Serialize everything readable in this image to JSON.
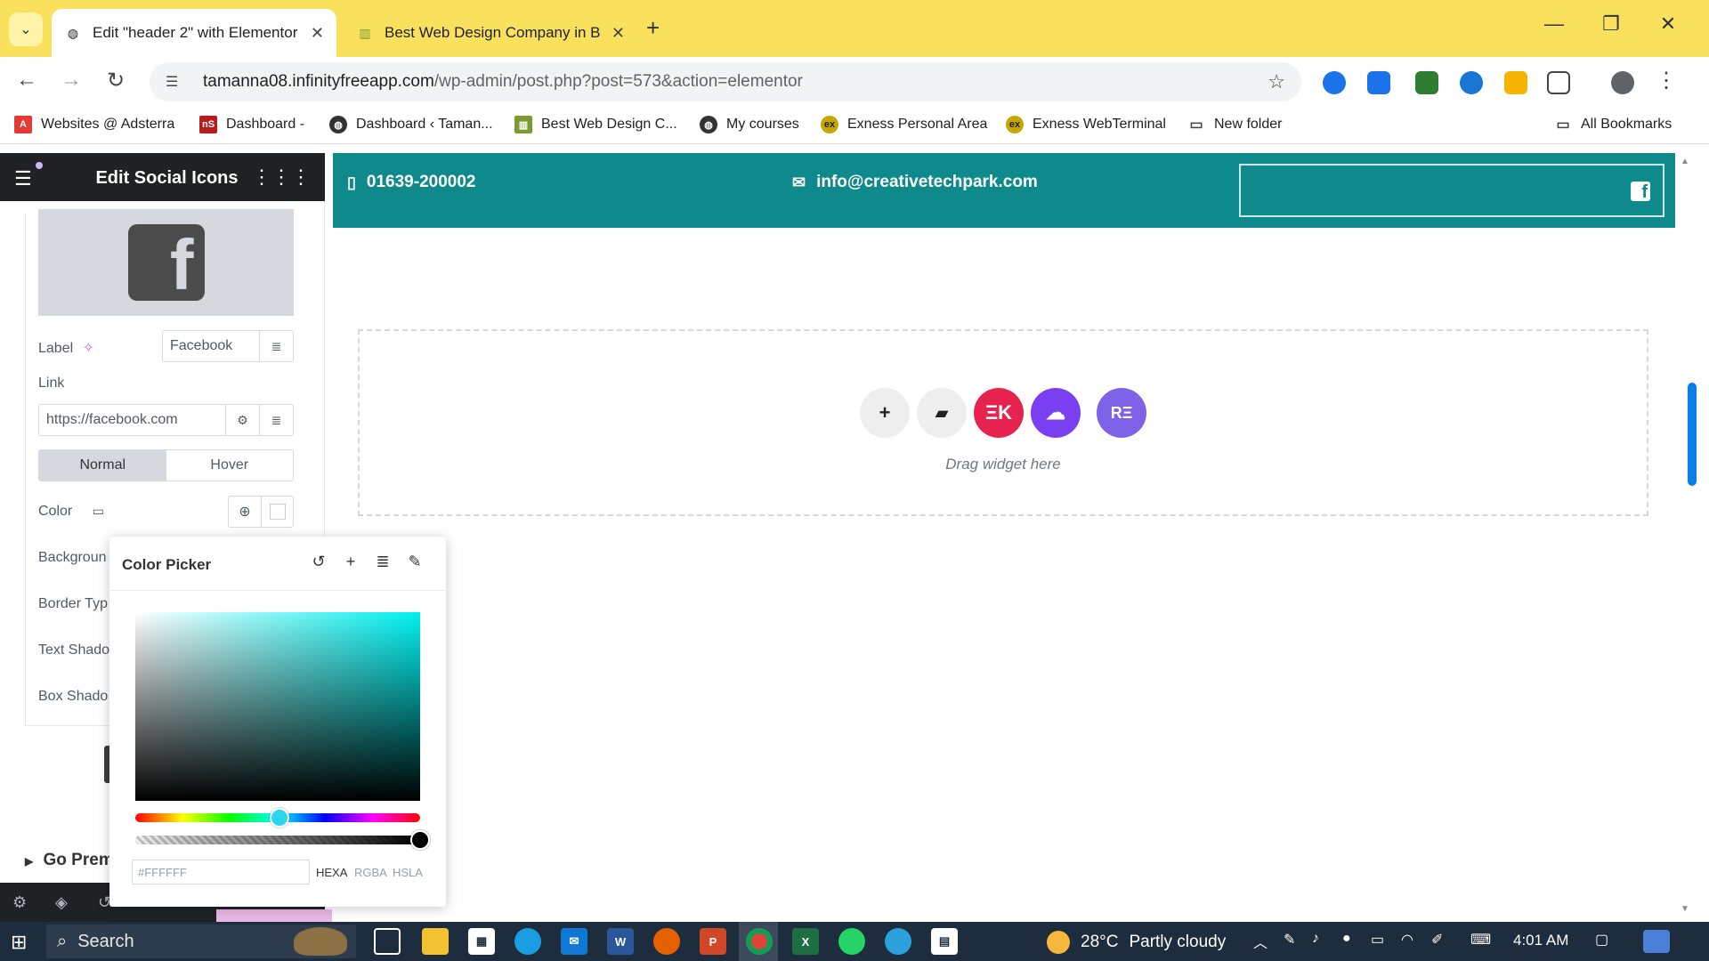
{
  "browser": {
    "tabs": [
      {
        "title": "Edit \"header 2\" with Elementor",
        "active": true
      },
      {
        "title": "Best Web Design Company in B",
        "active": false
      }
    ],
    "url_host": "tamanna08.infinityfreeapp.com",
    "url_path": "/wp-admin/post.php?post=573&action=elementor",
    "bookmarks": [
      {
        "label": "Websites @ Adsterra"
      },
      {
        "label": "Dashboard -"
      },
      {
        "label": "Dashboard ‹ Taman..."
      },
      {
        "label": "Best Web Design C..."
      },
      {
        "label": "My courses"
      },
      {
        "label": "Exness Personal Area"
      },
      {
        "label": "Exness WebTerminal"
      },
      {
        "label": "New folder"
      },
      {
        "label": "All Bookmarks"
      }
    ]
  },
  "panel": {
    "title": "Edit Social Icons",
    "label_text": "Label",
    "label_value": "Facebook",
    "link_text": "Link",
    "link_value": "https://facebook.com",
    "tab_normal": "Normal",
    "tab_hover": "Hover",
    "color_text": "Color",
    "background_text": "Backgroun",
    "border_type_text": "Border Typ",
    "text_shadow_text": "Text Shado",
    "box_shadow_text": "Box Shado",
    "go_premium": "Go Prem"
  },
  "color_picker": {
    "title": "Color Picker",
    "hex_value": "#FFFFFF",
    "formats": [
      "HEXA",
      "RGBA",
      "HSLA"
    ],
    "active_format": "HEXA",
    "hue_color": "#00f0f0"
  },
  "canvas": {
    "phone": "01639-200002",
    "email": "info@creativetechpark.com",
    "drop_text": "Drag widget here",
    "header_color": "#0e8a8c"
  },
  "taskbar": {
    "search_placeholder": "Search",
    "weather_temp": "28°C",
    "weather_desc": "Partly cloudy",
    "time": "4:01 AM"
  }
}
